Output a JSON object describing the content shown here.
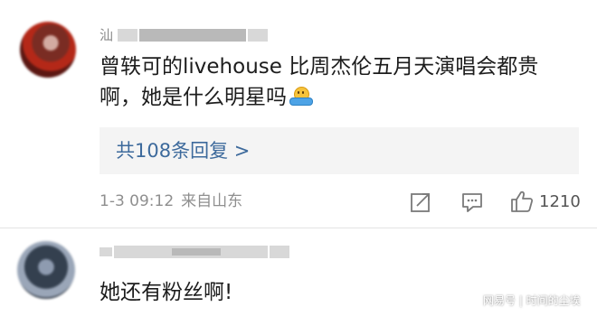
{
  "comments": [
    {
      "username_visible": "汕",
      "text_line1": "曾轶可的livehouse 比周杰伦五月天演唱会都贵",
      "text_line2": "啊，她是什么明星吗",
      "emoji": "hug-emoji",
      "replies_label": "共108条回复 >",
      "timestamp": "1-3 09:12",
      "source": "来自山东",
      "like_count": "1210"
    },
    {
      "username_visible": "",
      "text": "她还有粉丝啊!"
    }
  ],
  "watermark": "网易号 | 时间的尘埃",
  "colors": {
    "link": "#3d6a9c",
    "meta": "#8f8f8f",
    "reply_box_bg": "#f4f4f4",
    "text": "#1d1d1d"
  }
}
